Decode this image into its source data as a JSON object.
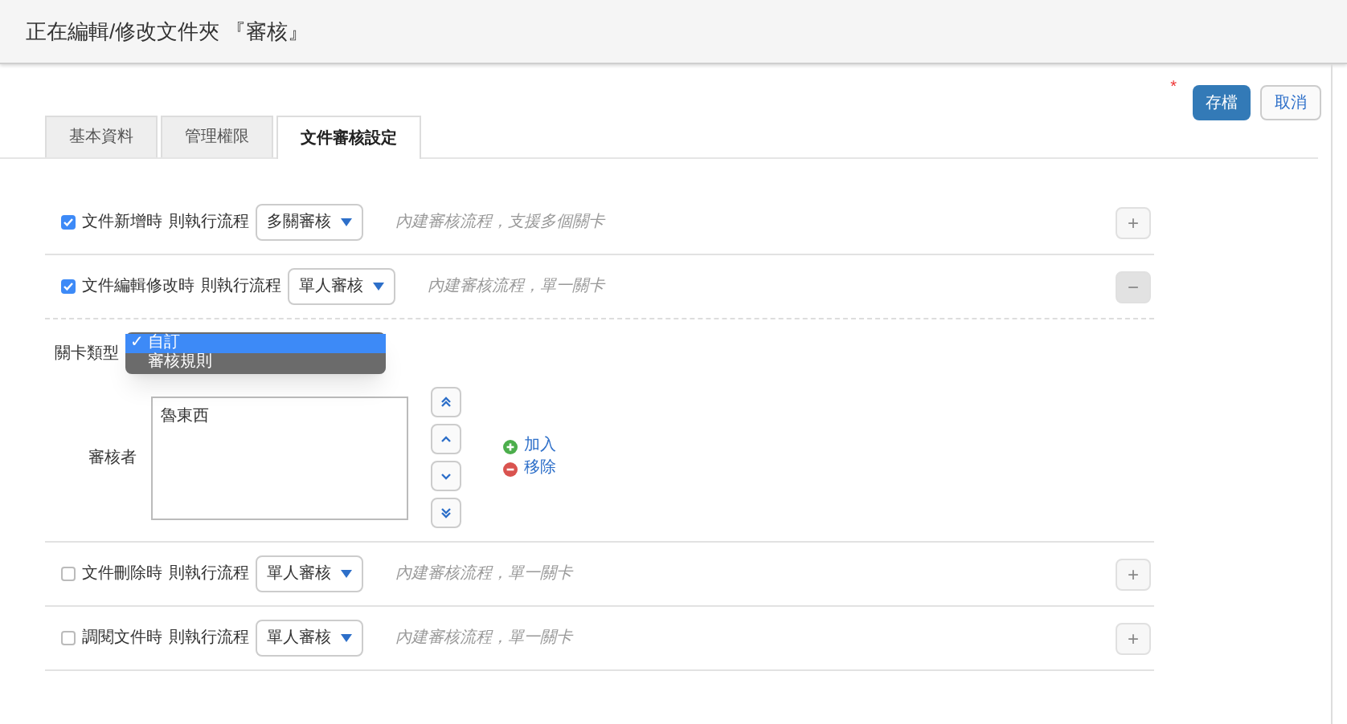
{
  "header": {
    "title": "正在編輯/修改文件夾 『審核』"
  },
  "actions": {
    "required_mark": "*",
    "save": "存檔",
    "cancel": "取消"
  },
  "tabs": [
    {
      "label": "基本資料",
      "selected": false
    },
    {
      "label": "管理權限",
      "selected": false
    },
    {
      "label": "文件審核設定",
      "selected": true
    }
  ],
  "rules": [
    {
      "checked": true,
      "event": "文件新增時",
      "action": "則執行流程",
      "flow": "多關審核",
      "note": "內建審核流程，支援多個關卡",
      "expanded": false,
      "toggle": "+"
    },
    {
      "checked": true,
      "event": "文件編輯修改時",
      "action": "則執行流程",
      "flow": "單人審核",
      "note": "內建審核流程，單一關卡",
      "expanded": true,
      "toggle": "−"
    },
    {
      "checked": false,
      "event": "文件刪除時",
      "action": "則執行流程",
      "flow": "單人審核",
      "note": "內建審核流程，單一關卡",
      "expanded": false,
      "toggle": "+"
    },
    {
      "checked": false,
      "event": "調閱文件時",
      "action": "則執行流程",
      "flow": "單人審核",
      "note": "內建審核流程，單一關卡",
      "expanded": false,
      "toggle": "+"
    }
  ],
  "detail": {
    "gate_type_label": "關卡類型",
    "gate_options": [
      {
        "label": "自訂",
        "selected": true,
        "check": "✓"
      },
      {
        "label": "審核規則",
        "selected": false
      }
    ],
    "reviewers_label": "審核者",
    "reviewers": [
      "魯東西"
    ],
    "add": "加入",
    "remove": "移除"
  }
}
